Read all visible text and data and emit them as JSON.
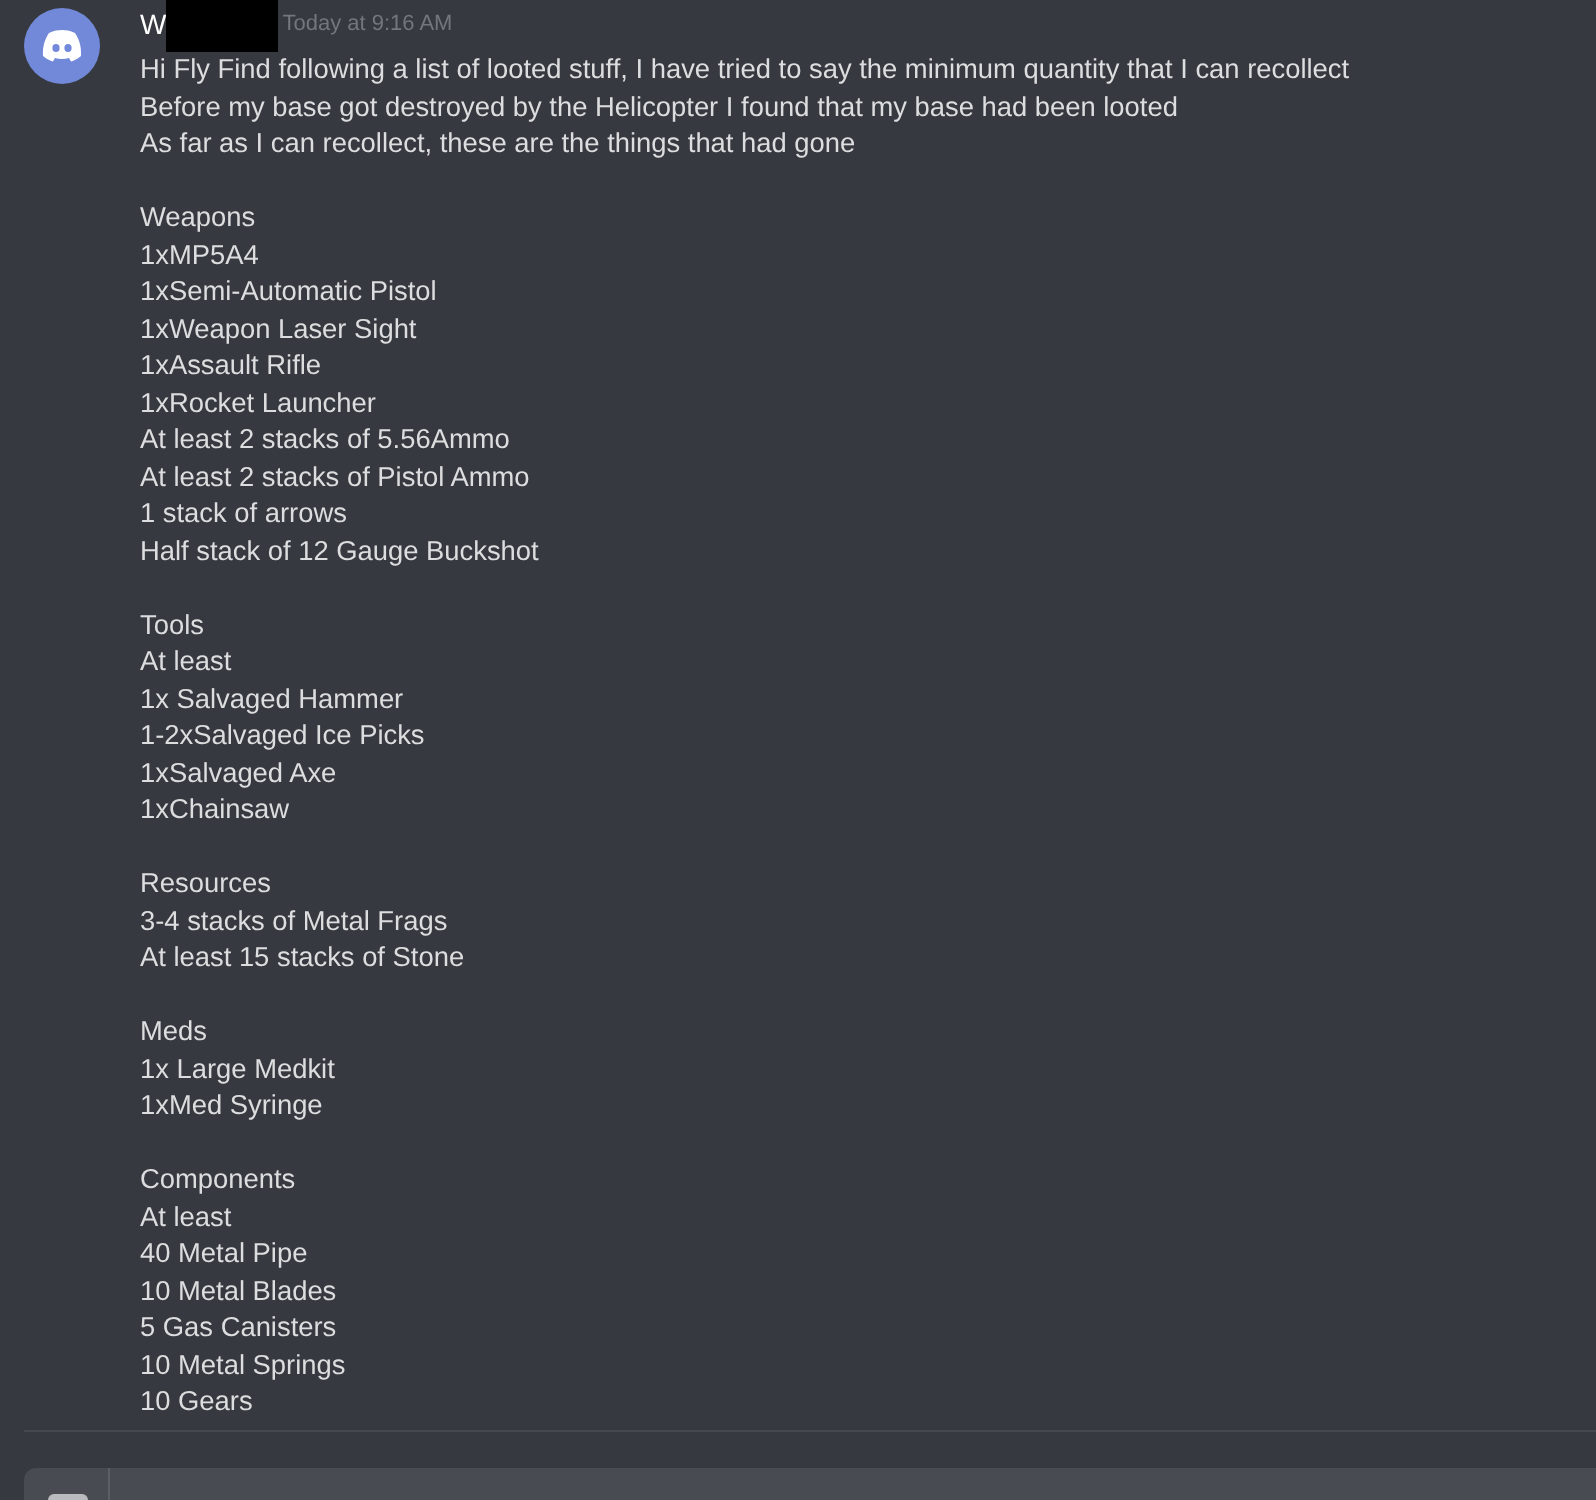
{
  "message": {
    "author": "W",
    "author_redacted": true,
    "timestamp": "Today at 9:16 AM",
    "intro": [
      "Hi Fly Find following a list of looted stuff, I have tried to say the minimum quantity that I can recollect",
      "Before my base got destroyed by the Helicopter I found that my base had been looted",
      "As far as I can recollect, these are the things that had gone"
    ],
    "sections": [
      {
        "heading": "Weapons",
        "items": [
          "1xMP5A4",
          "1xSemi-Automatic Pistol",
          "1xWeapon Laser Sight",
          "1xAssault Rifle",
          "1xRocket Launcher",
          "At least 2 stacks of 5.56Ammo",
          "At least 2 stacks of Pistol Ammo",
          "1 stack of arrows",
          "Half stack of 12 Gauge Buckshot"
        ]
      },
      {
        "heading": "Tools",
        "items": [
          "At least",
          "1x Salvaged Hammer",
          "1-2xSalvaged Ice Picks",
          "1xSalvaged Axe",
          "1xChainsaw"
        ]
      },
      {
        "heading": "Resources",
        "items": [
          "3-4 stacks of Metal Frags",
          "At least 15 stacks of Stone"
        ]
      },
      {
        "heading": "Meds",
        "items": [
          "1x Large Medkit",
          "1xMed Syringe"
        ]
      },
      {
        "heading": "Components",
        "items": [
          "At least",
          "40 Metal Pipe",
          "10 Metal Blades",
          "5 Gas Canisters",
          "10 Metal Springs",
          "10 Gears"
        ]
      }
    ]
  }
}
